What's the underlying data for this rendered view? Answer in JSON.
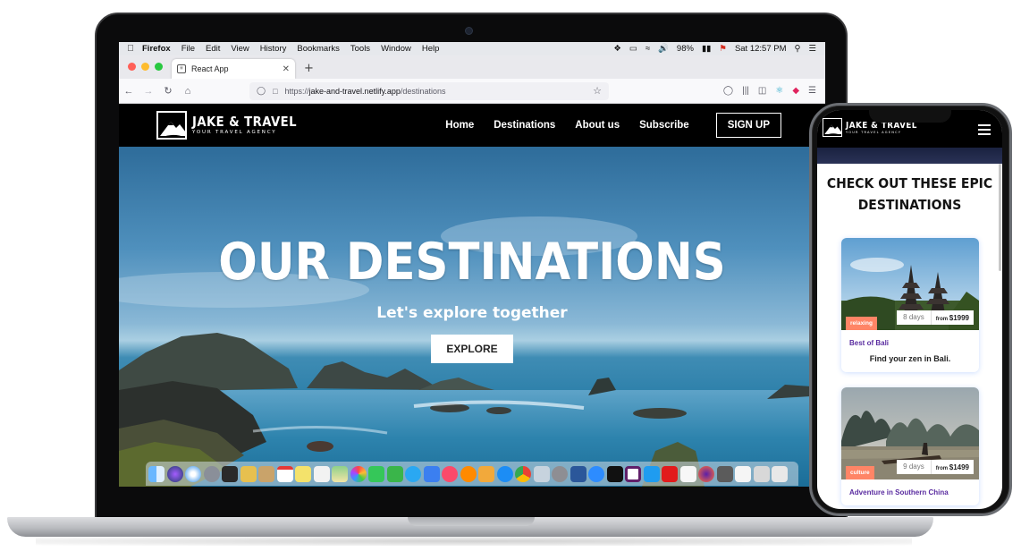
{
  "menubar": {
    "app_name": "Firefox",
    "items": [
      "File",
      "Edit",
      "View",
      "History",
      "Bookmarks",
      "Tools",
      "Window",
      "Help"
    ],
    "battery": "98%",
    "clock": "Sat 12:57 PM"
  },
  "browser": {
    "tab_title": "React App",
    "url_prefix": "https://",
    "url_main": "jake-and-travel.netlify.app",
    "url_path": "/destinations"
  },
  "site": {
    "logo_title": "JAKE & TRAVEL",
    "logo_subtitle": "YOUR TRAVEL AGENCY",
    "nav": [
      "Home",
      "Destinations",
      "About us",
      "Subscribe"
    ],
    "signup_label": "SIGN UP",
    "hero_title": "OUR DESTINATIONS",
    "hero_subtitle": "Let's explore together",
    "explore_label": "EXPLORE"
  },
  "mobile": {
    "heading": "CHECK OUT THESE EPIC DESTINATIONS",
    "cards": [
      {
        "tag": "relaxing",
        "days": "8 days",
        "price_prefix": "from",
        "price": "$1999",
        "title": "Best of Bali",
        "description": "Find your zen in Bali."
      },
      {
        "tag": "culture",
        "days": "9 days",
        "price_prefix": "from",
        "price": "$1499",
        "title": "Adventure in Southern China",
        "description": ""
      }
    ]
  },
  "colors": {
    "accent_tag": "#ff8566",
    "card_title": "#5a2ca0",
    "nav_bg": "#000000"
  }
}
